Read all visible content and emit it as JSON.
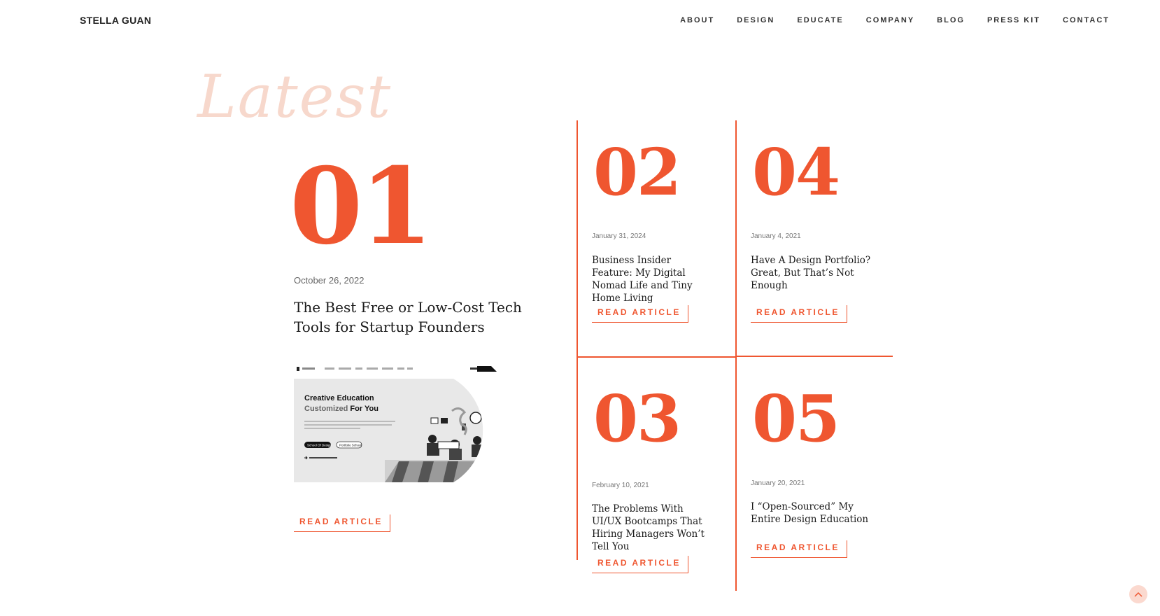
{
  "header": {
    "logo": "STELLA GUAN",
    "nav": [
      "ABOUT",
      "DESIGN",
      "EDUCATE",
      "COMPANY",
      "BLOG",
      "PRESS KIT",
      "CONTACT"
    ]
  },
  "section": {
    "script_title": "Latest"
  },
  "feature": {
    "number": "01",
    "date": "October 26, 2022",
    "title": "The Best Free or Low-Cost Tech Tools for Startup Founders",
    "read_label": "READ ARTICLE",
    "thumb": {
      "headline_1": "Creative Education",
      "headline_2a": "Customized",
      "headline_2b": " For You",
      "btn_1": "School Of Design",
      "btn_2": "Portfolio School"
    }
  },
  "articles": [
    {
      "number": "02",
      "date": "January 31, 2024",
      "title": "Business Insider Feature: My Digital Nomad Life and Tiny Home Living",
      "read_label": "READ ARTICLE"
    },
    {
      "number": "04",
      "date": "January 4, 2021",
      "title": "Have A Design Portfolio? Great, But That’s Not Enough",
      "read_label": "READ ARTICLE"
    },
    {
      "number": "03",
      "date": "February 10, 2021",
      "title": "The Problems With UI/UX Bootcamps That Hiring Managers Won’t Tell You",
      "read_label": "READ ARTICLE"
    },
    {
      "number": "05",
      "date": "January 20, 2021",
      "title": "I “Open-Sourced” My Entire Design Education",
      "read_label": "READ ARTICLE"
    }
  ],
  "colors": {
    "accent": "#ef5630",
    "script": "#f7d8cc"
  },
  "icons": {
    "scroll_top": "chevron-up-icon"
  }
}
